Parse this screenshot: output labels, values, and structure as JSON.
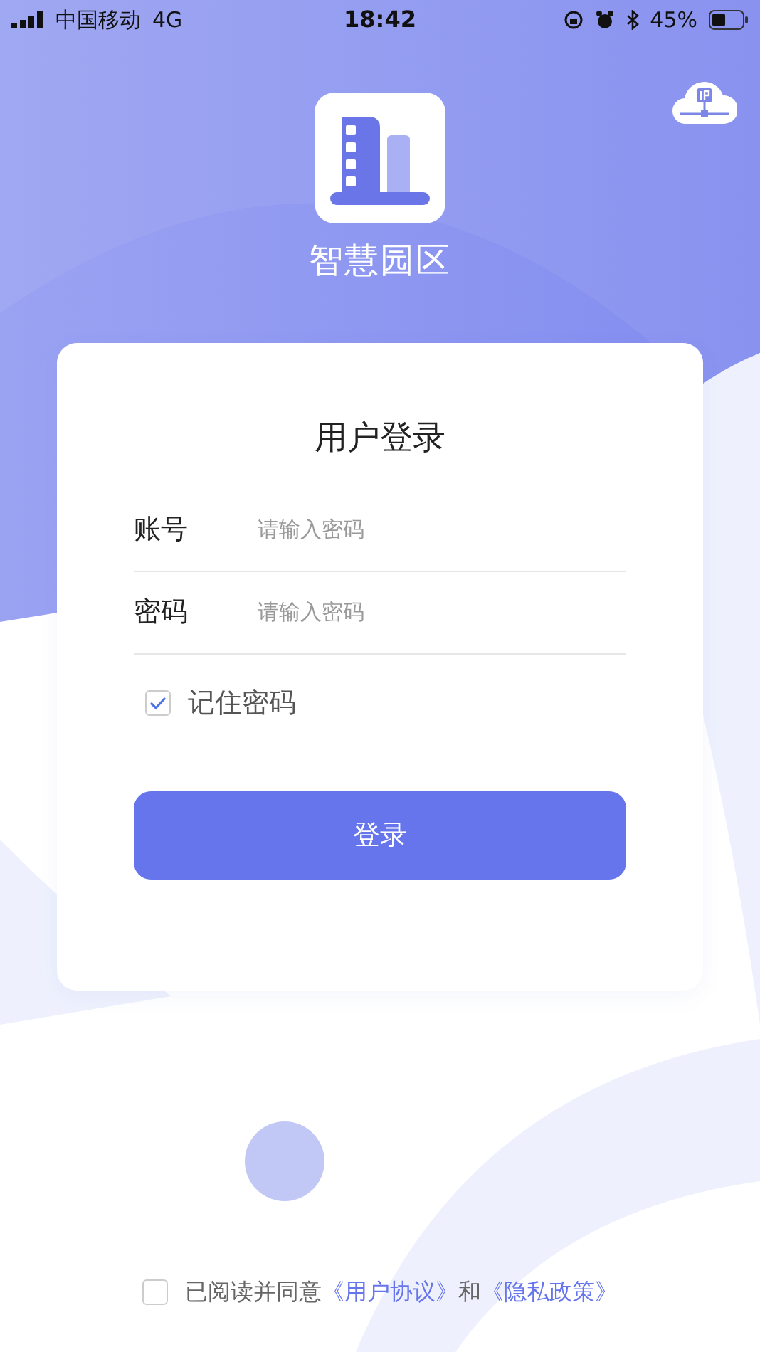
{
  "status_bar": {
    "carrier": "中国移动",
    "network": "4G",
    "time": "18:42",
    "battery": "45%"
  },
  "app_name": "智慧园区",
  "login": {
    "title": "用户登录",
    "fields": [
      {
        "label": "账号",
        "placeholder": "请输入密码"
      },
      {
        "label": "密码",
        "placeholder": "请输入密码"
      }
    ],
    "remember": {
      "label": "记住密码",
      "checked": true
    },
    "button": "登录"
  },
  "agreement": {
    "checked": false,
    "text": "已阅读并同意",
    "link_1": "《用户协议》",
    "conjunction": "和",
    "link_2": "《隐私政策》"
  }
}
